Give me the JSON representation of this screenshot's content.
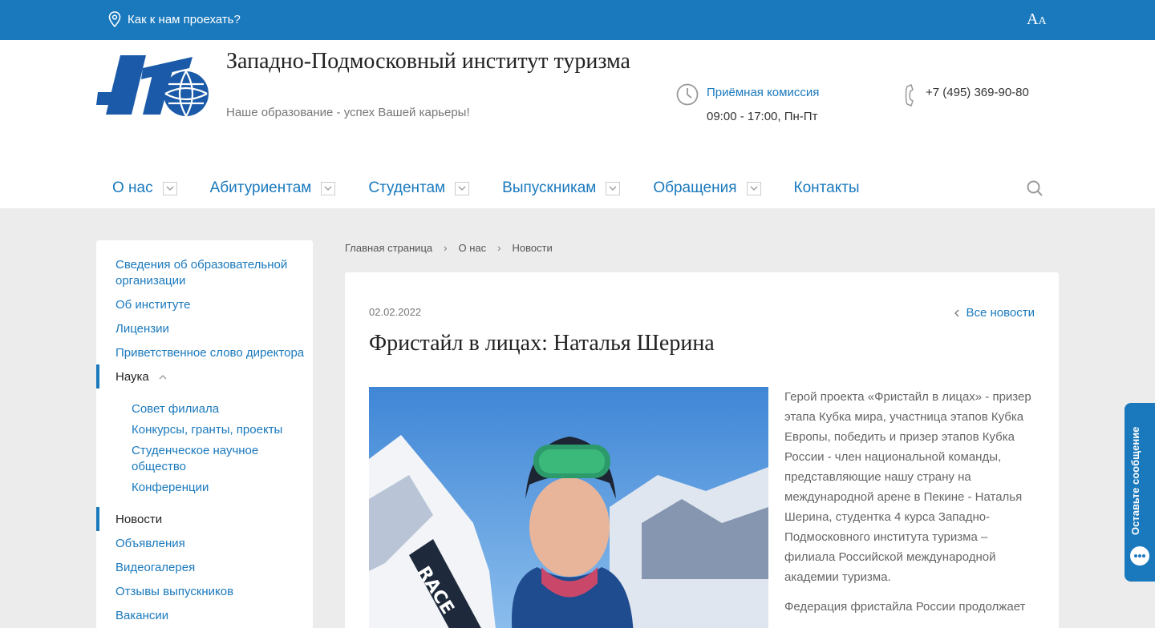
{
  "topbar": {
    "location_link": "Как к нам проехать?",
    "font_big": "A",
    "font_small": "A"
  },
  "header": {
    "title": "Западно-Подмосковный институт туризма",
    "slogan": "Наше образование - успех Вашей карьеры!",
    "admissions_label": "Приёмная комиссия",
    "admissions_hours": "09:00 - 17:00, Пн-Пт",
    "phone": "+7 (495) 369-90-80"
  },
  "nav": {
    "items": [
      {
        "label": "О нас",
        "dropdown": true
      },
      {
        "label": "Абитуриентам",
        "dropdown": true
      },
      {
        "label": "Студентам",
        "dropdown": true
      },
      {
        "label": "Выпускникам",
        "dropdown": true
      },
      {
        "label": "Обращения",
        "dropdown": true
      },
      {
        "label": "Контакты",
        "dropdown": false
      }
    ]
  },
  "sidebar": {
    "items": [
      "Сведения об образовательной организации",
      "Об институте",
      "Лицензии",
      "Приветственное слово директора",
      "Наука",
      "Новости",
      "Объявления",
      "Видеогалерея",
      "Отзывы выпускников",
      "Вакансии"
    ],
    "sub_items": [
      "Совет филиала",
      "Конкурсы, гранты, проекты",
      "Студенческое научное общество",
      "Конференции"
    ]
  },
  "breadcrumb": [
    "Главная страница",
    "О нас",
    "Новости"
  ],
  "article": {
    "date": "02.02.2022",
    "all_news": "Все новости",
    "title": "Фристайл в лицах: Наталья Шерина",
    "paragraphs": [
      "Герой проекта «Фристайл в лицах» - призер этапа Кубка мира, участница этапов Кубка Европы, победить и призер этапов Кубка России - член национальной команды, представляющие нашу страну на международной арене в Пекине - Наталья Шерина, студентка 4 курса  Западно-Подмосковного института туризма – филиала Российской международной академии туризма.",
      "Федерация фристайла России продолжает"
    ],
    "ski_text": "RACE"
  },
  "feedback": {
    "label": "Оставьте сообщение"
  },
  "colors": {
    "accent": "#1a79bd",
    "background": "#ececec"
  }
}
